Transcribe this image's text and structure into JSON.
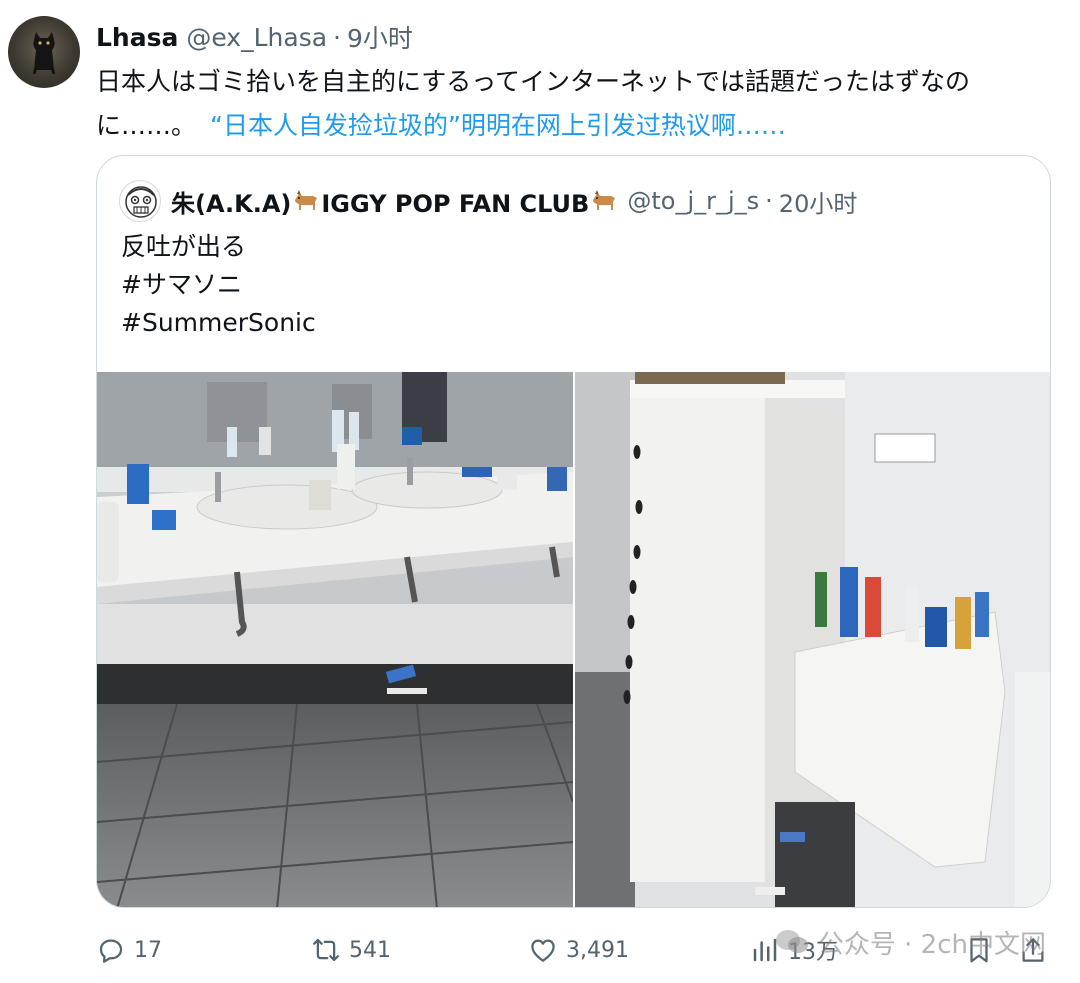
{
  "tweet": {
    "author_name": "Lhasa",
    "author_handle": "@ex_Lhasa",
    "separator": "·",
    "time": "9小时",
    "text_original": "日本人はゴミ拾いを自主的にするってインターネットでは話題だったはずなのに……。",
    "text_translation": "“日本人自发捡垃圾的”明明在网上引发过热议啊……"
  },
  "quoted": {
    "author_name": "朱(A.K.A)",
    "author_name_rest": "IGGY POP FAN CLUB",
    "name_emoji": "dog-emoji",
    "author_handle": "@to_j_r_j_s",
    "separator": "·",
    "time": "20小时",
    "lines": [
      "反吐が出る",
      "#サマソニ",
      "#SummerSonic"
    ]
  },
  "photos": [
    {
      "name": "restroom-sinks-photo",
      "description_icon": "photo"
    },
    {
      "name": "baby-changing-table-photo",
      "description_icon": "photo"
    }
  ],
  "actions": {
    "reply_count": "17",
    "retweet_count": "541",
    "like_count": "3,491",
    "view_count": "13万"
  },
  "watermark": {
    "text": "公众号 · 2ch中文网"
  },
  "colors": {
    "link": "#1d9bf0",
    "secondary": "#536471",
    "border": "#cfd9de",
    "text": "#0f1419"
  }
}
